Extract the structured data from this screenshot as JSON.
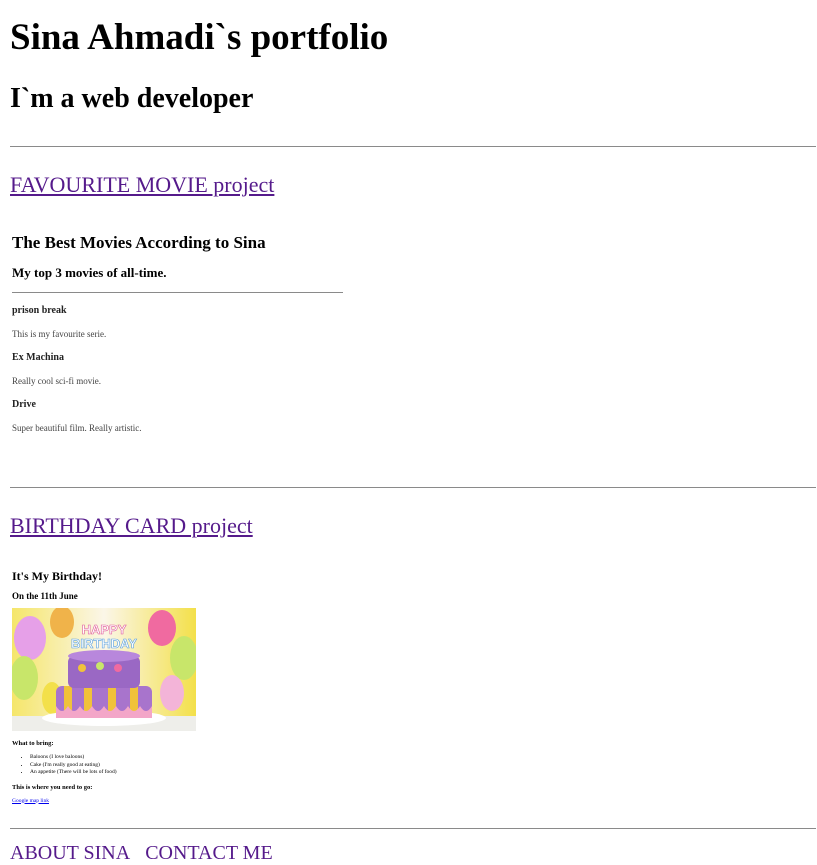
{
  "header": {
    "title": "Sina Ahmadi`s portfolio",
    "tagline": "I`m a web developer"
  },
  "projects": {
    "movie": {
      "link_label": "FAVOURITE MOVIE project",
      "embed": {
        "title": "The Best Movies According to Sina",
        "subtitle": "My top 3 movies of all-time.",
        "movies": [
          {
            "name": "prison break",
            "desc": "This is my favourite serie."
          },
          {
            "name": "Ex Machina",
            "desc": "Really cool sci-fi movie."
          },
          {
            "name": "Drive",
            "desc": "Super beautiful film. Really artistic."
          }
        ]
      }
    },
    "birthday": {
      "link_label": "BIRTHDAY CARD project",
      "embed": {
        "title": "It's My Birthday!",
        "date": "On the 11th June",
        "image_alt": "birthday cake",
        "bring_heading": "What to bring:",
        "bring_items": [
          "Baloons (I love baloons)",
          "Cake (I'm really good at eating)",
          "An appetite (There will be lots of food)"
        ],
        "where_heading": "This is where you need to go:",
        "map_link": "Google map link"
      }
    }
  },
  "footer": {
    "about": "ABOUT SINA",
    "contact": "CONTACT ME"
  },
  "colors": {
    "visited_link": "#551a8b",
    "divider": "#8a8a8a"
  }
}
